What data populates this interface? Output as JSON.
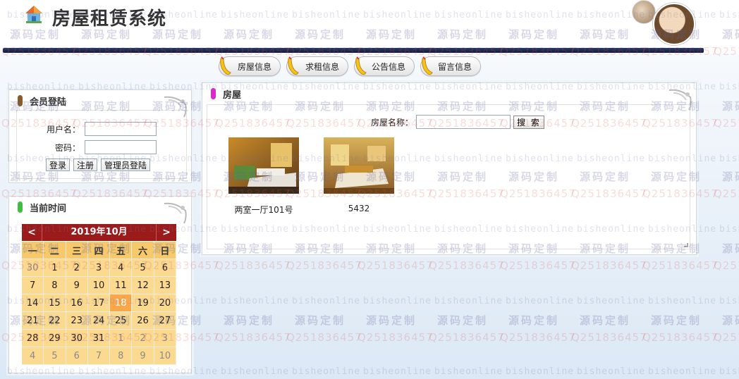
{
  "header": {
    "title": "房屋租赁系统"
  },
  "nav": {
    "items": [
      {
        "label": "房屋信息"
      },
      {
        "label": "求租信息"
      },
      {
        "label": "公告信息"
      },
      {
        "label": "留言信息"
      }
    ]
  },
  "login": {
    "title": "会员登陆",
    "username_label": "用户名：",
    "password_label": "密码：",
    "username_value": "",
    "password_value": "",
    "login_button": "登录",
    "register_button": "注册",
    "admin_button": "管理员登陆"
  },
  "clock": {
    "title": "当前时间",
    "prev": "<",
    "next": ">",
    "month_title": "2019年10月",
    "weekdays": [
      "一",
      "二",
      "三",
      "四",
      "五",
      "六",
      "日"
    ],
    "weeks": [
      [
        "30",
        "1",
        "2",
        "3",
        "4",
        "5",
        "6"
      ],
      [
        "7",
        "8",
        "9",
        "10",
        "11",
        "12",
        "13"
      ],
      [
        "14",
        "15",
        "16",
        "17",
        "18",
        "19",
        "20"
      ],
      [
        "21",
        "22",
        "23",
        "24",
        "25",
        "26",
        "27"
      ],
      [
        "28",
        "29",
        "30",
        "31",
        "1",
        "2",
        "3"
      ],
      [
        "4",
        "5",
        "6",
        "7",
        "8",
        "9",
        "10"
      ]
    ],
    "today": "18"
  },
  "houses": {
    "title": "房屋",
    "search_label": "房屋名称：",
    "search_value": "",
    "search_button": "搜 索",
    "items": [
      {
        "name": "两室一厅101号"
      },
      {
        "name": "5432"
      }
    ]
  },
  "watermarks": {
    "site": "bisheonline",
    "code": "源码定制",
    "qq": "Q251836457"
  },
  "colors": {
    "accent_red": "#9b1b1b",
    "calendar_bg": "#fbd98f",
    "calendar_today": "#f8a84a",
    "header_bar": "#1f2d58"
  }
}
